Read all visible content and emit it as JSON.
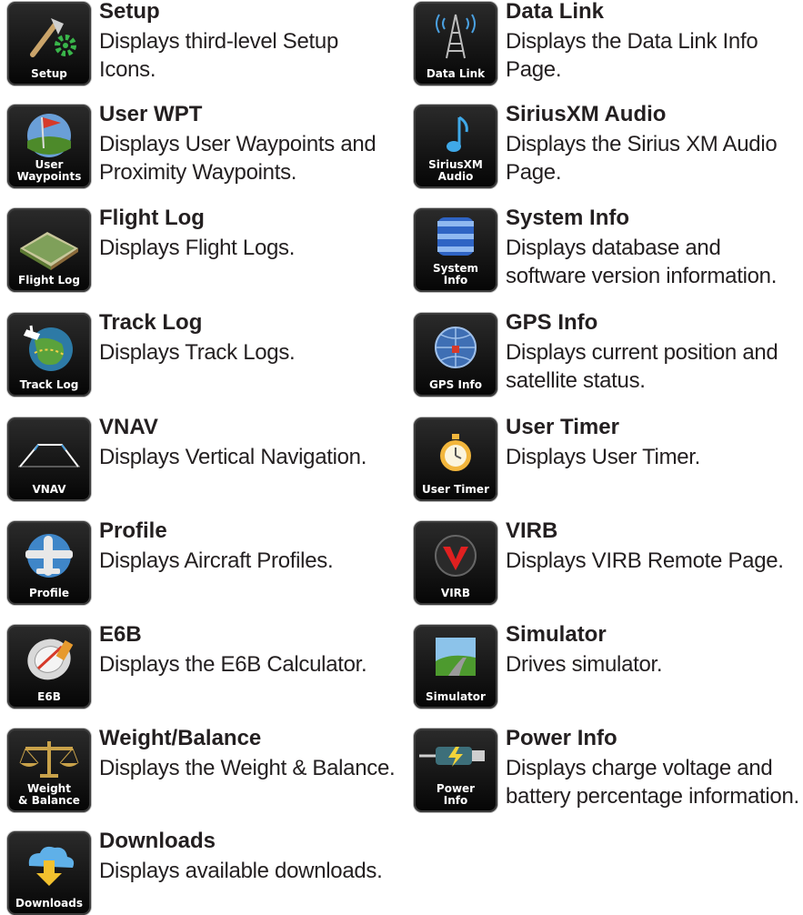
{
  "left_column": [
    {
      "title": "Setup",
      "desc": "Displays third-level Setup Icons.",
      "icon_label": "Setup",
      "icon": "setup-icon"
    },
    {
      "title": "User WPT",
      "desc": "Displays User Waypoints and Proximity Waypoints.",
      "icon_label": "User\nWaypoints",
      "icon": "user-waypoints-icon"
    },
    {
      "title": "Flight Log",
      "desc": "Displays Flight Logs.",
      "icon_label": "Flight Log",
      "icon": "flight-log-icon"
    },
    {
      "title": "Track Log",
      "desc": "Displays Track Logs.",
      "icon_label": "Track Log",
      "icon": "track-log-icon"
    },
    {
      "title": "VNAV",
      "desc": "Displays Vertical Navigation.",
      "icon_label": "VNAV",
      "icon": "vnav-icon"
    },
    {
      "title": "Profile",
      "desc": "Displays Aircraft Profiles.",
      "icon_label": "Profile",
      "icon": "profile-icon"
    },
    {
      "title": "E6B",
      "desc": "Displays the E6B Calculator.",
      "icon_label": "E6B",
      "icon": "e6b-icon"
    },
    {
      "title": "Weight/Balance",
      "desc": "Displays the Weight & Balance.",
      "icon_label": "Weight\n& Balance",
      "icon": "weight-balance-icon"
    },
    {
      "title": "Downloads",
      "desc": "Displays available downloads.",
      "icon_label": "Downloads",
      "icon": "downloads-icon"
    }
  ],
  "right_column": [
    {
      "title": "Data Link",
      "desc": "Displays the Data Link Info Page.",
      "icon_label": "Data Link",
      "icon": "data-link-icon"
    },
    {
      "title": "SiriusXM Audio",
      "desc": "Displays the Sirius XM Audio Page.",
      "icon_label": "SiriusXM\nAudio",
      "icon": "siriusxm-audio-icon"
    },
    {
      "title": "System Info",
      "desc": "Displays database and software version information.",
      "icon_label": "System\nInfo",
      "icon": "system-info-icon"
    },
    {
      "title": "GPS Info",
      "desc": "Displays current position and satellite status.",
      "icon_label": "GPS Info",
      "icon": "gps-info-icon"
    },
    {
      "title": "User Timer",
      "desc": "Displays User Timer.",
      "icon_label": "User Timer",
      "icon": "user-timer-icon"
    },
    {
      "title": "VIRB",
      "desc": "Displays VIRB Remote Page.",
      "icon_label": "VIRB",
      "icon": "virb-icon"
    },
    {
      "title": "Simulator",
      "desc": "Drives simulator.",
      "icon_label": "Simulator",
      "icon": "simulator-icon"
    },
    {
      "title": "Power Info",
      "desc": "Displays charge voltage and battery percentage information.",
      "icon_label": "Power\nInfo",
      "icon": "power-info-icon"
    }
  ]
}
